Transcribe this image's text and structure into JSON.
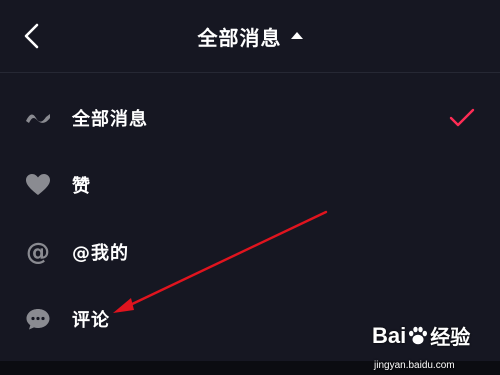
{
  "header": {
    "title": "全部消息",
    "back_icon": "chevron-left-icon",
    "title_caret_icon": "caret-up-icon"
  },
  "menu": {
    "items": [
      {
        "label": "全部消息",
        "icon": "wave-icon",
        "selected": true
      },
      {
        "label": "赞",
        "icon": "heart-icon",
        "selected": false
      },
      {
        "label": "@我的",
        "icon": "at-icon",
        "icon_glyph": "@",
        "selected": false
      },
      {
        "label": "评论",
        "icon": "comment-icon",
        "selected": false
      }
    ],
    "check_icon": "checkmark-icon"
  },
  "annotation": {
    "type": "red-arrow",
    "color": "#e0141e",
    "points_to": "评论"
  },
  "watermark": {
    "logo_text_left": "Bai",
    "logo_text_right": "经验",
    "subtext": "jingyan.baidu.com"
  },
  "colors": {
    "background": "#161722",
    "text": "#ffffff",
    "icon_gray": "#8a8b91",
    "accent_check": "#fe2c55",
    "divider": "#262834"
  }
}
